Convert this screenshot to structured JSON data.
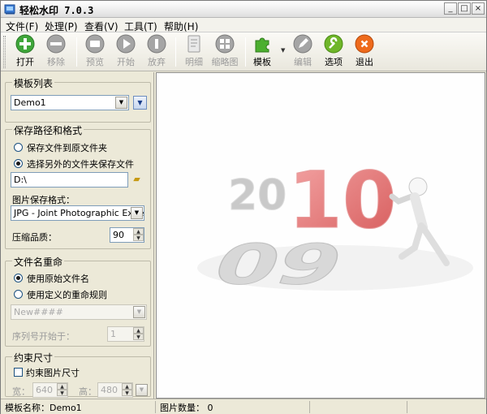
{
  "window": {
    "title": "轻松水印 7.0.3"
  },
  "menu": [
    {
      "label": "文件(F)"
    },
    {
      "label": "处理(P)"
    },
    {
      "label": "查看(V)"
    },
    {
      "label": "工具(T)"
    },
    {
      "label": "帮助(H)"
    }
  ],
  "toolbar": {
    "buttons": [
      {
        "label": "打开",
        "icon": "plus-icon",
        "enabled": true,
        "color": "#3fa63a"
      },
      {
        "label": "移除",
        "icon": "minus-icon",
        "enabled": false,
        "color": "#9c9c9c"
      },
      {
        "label": "预览",
        "icon": "preview-icon",
        "enabled": false,
        "color": "#9c9c9c"
      },
      {
        "label": "开始",
        "icon": "play-icon",
        "enabled": false,
        "color": "#9c9c9c"
      },
      {
        "label": "放弃",
        "icon": "pause-icon",
        "enabled": false,
        "color": "#9c9c9c"
      },
      {
        "label": "明细",
        "icon": "document-icon",
        "enabled": false,
        "color": "#9c9c9c"
      },
      {
        "label": "缩略图",
        "icon": "thumbnails-icon",
        "enabled": false,
        "color": "#9c9c9c"
      },
      {
        "label": "模板",
        "icon": "puzzle-icon",
        "enabled": true,
        "color": "#4caf2f"
      },
      {
        "label": "编辑",
        "icon": "pencil-icon",
        "enabled": false,
        "color": "#9c9c9c"
      },
      {
        "label": "选项",
        "icon": "wrench-icon",
        "enabled": true,
        "color": "#6fb629"
      },
      {
        "label": "退出",
        "icon": "exit-icon",
        "enabled": true,
        "color": "#ee6a1c"
      }
    ]
  },
  "template_list": {
    "title": "模板列表",
    "selected": "Demo1"
  },
  "save_path": {
    "title": "保存路径和格式",
    "option_original": "保存文件到原文件夹",
    "option_other": "选择另外的文件夹保存文件",
    "selected_option": "other",
    "path_value": "D:\\",
    "format_label": "图片保存格式：",
    "format_value": "JPG - Joint Photographic Experts Group",
    "quality_label": "压缩品质：",
    "quality_value": "90"
  },
  "rename": {
    "title": "文件名重命",
    "option_original": "使用原始文件名",
    "option_custom": "使用定义的重命规则",
    "selected_option": "original",
    "pattern_value": "New####",
    "seq_label": "序列号开始于：",
    "seq_value": "1"
  },
  "constraint": {
    "title": "约束尺寸",
    "checkbox_label": "约束图片尺寸",
    "checked": false,
    "width_label": "宽：",
    "width_value": "640",
    "height_label": "高：",
    "height_value": "480"
  },
  "preview": {
    "digits_back": "20",
    "digits_front": "10",
    "digits_side": "09",
    "accent_color": "#e06060"
  },
  "status": {
    "template_name": "模板名称：Demo1",
    "image_count": "图片数量： 0"
  }
}
